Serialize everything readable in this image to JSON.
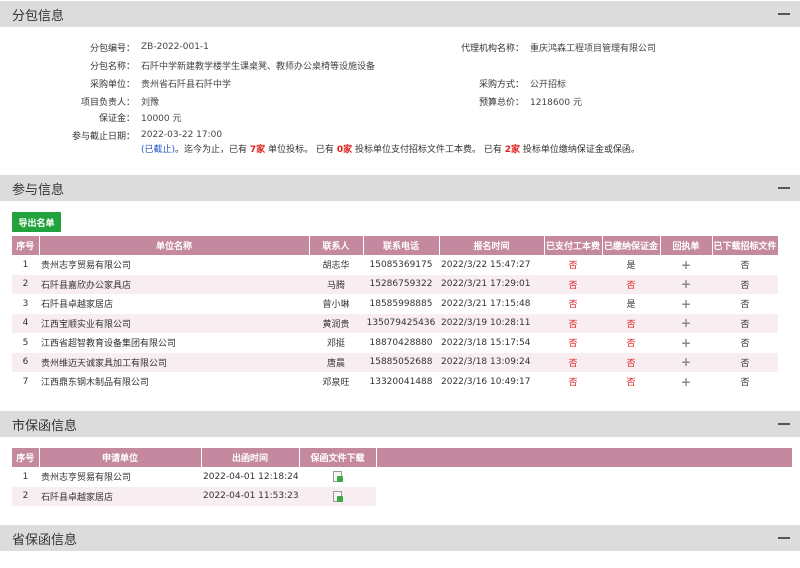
{
  "sections": {
    "package_info": "分包信息",
    "participants": "参与信息",
    "city_guarantee": "市保函信息",
    "province_guarantee": "省保函信息"
  },
  "info": {
    "pkg_no_label": "分包编号：",
    "pkg_no": "ZB-2022-001-1",
    "agency_label": "代理机构名称：",
    "agency": "重庆鸿森工程项目管理有限公司",
    "pkg_name_label": "分包名称：",
    "pkg_name": "石阡中学新建教学楼学生课桌凳、教师办公桌椅等设施设备",
    "buyer_label": "采购单位：",
    "buyer": "贵州省石阡县石阡中学",
    "method_label": "采购方式：",
    "method": "公开招标",
    "manager_label": "项目负责人：",
    "manager": "刘豫",
    "budget_label": "预算总价：",
    "budget": "1218600 元",
    "deposit_label": "保证金：",
    "deposit": "10000 元",
    "deadline_label": "参与截止日期：",
    "deadline": "2022-03-22 17:00"
  },
  "status": {
    "closed": "(已截止)",
    "t1": "。迄今为止，已有",
    "n1": "7家",
    "t2": "单位投标。 已有",
    "n2": "0家",
    "t3": "投标单位支付招标文件工本费。 已有",
    "n3": "2家",
    "t4": "投标单位缴纳保证金或保函。"
  },
  "export_button": "导出名单",
  "participants_table": {
    "headers": [
      "序号",
      "单位名称",
      "联系人",
      "联系电话",
      "报名时间",
      "已支付工本费",
      "已缴纳保证金",
      "回执单",
      "已下载招标文件"
    ],
    "rows": [
      [
        "1",
        "贵州志亨贸易有限公司",
        "胡志华",
        "15085369175",
        "2022/3/22 15:47:27",
        "否",
        "是",
        "+",
        "否"
      ],
      [
        "2",
        "石阡县嘉欣办公家具店",
        "马腾",
        "15286759322",
        "2022/3/21 17:29:01",
        "否",
        "否",
        "+",
        "否"
      ],
      [
        "3",
        "石阡县卓越家居店",
        "曾小琳",
        "18585998885",
        "2022/3/21 17:15:48",
        "否",
        "是",
        "+",
        "否"
      ],
      [
        "4",
        "江西宝顺实业有限公司",
        "黄润贵",
        "135079425436",
        "2022/3/19 10:28:11",
        "否",
        "否",
        "+",
        "否"
      ],
      [
        "5",
        "江西省超智教育设备集团有限公司",
        "邓挺",
        "18870428880",
        "2022/3/18 15:17:54",
        "否",
        "否",
        "+",
        "否"
      ],
      [
        "6",
        "贵州维迈天诚家具加工有限公司",
        "唐晨",
        "15885052688",
        "2022/3/18 13:09:24",
        "否",
        "否",
        "+",
        "否"
      ],
      [
        "7",
        "江西鼎东钢木制品有限公司",
        "邓泉旺",
        "13320041488",
        "2022/3/16 10:49:17",
        "否",
        "否",
        "+",
        "否"
      ]
    ]
  },
  "guarantee_table": {
    "headers": [
      "序号",
      "申请单位",
      "出函时间",
      "保函文件下载"
    ],
    "rows": [
      [
        "1",
        "贵州志亨贸易有限公司",
        "2022-04-01 12:18:24"
      ],
      [
        "2",
        "石阡县卓越家居店",
        "2022-04-01 11:53:23"
      ]
    ]
  },
  "colors": {
    "header_bg": "#c4889f",
    "accent_green": "#22a23c",
    "red": "#e02020",
    "blue": "#2255cc"
  }
}
